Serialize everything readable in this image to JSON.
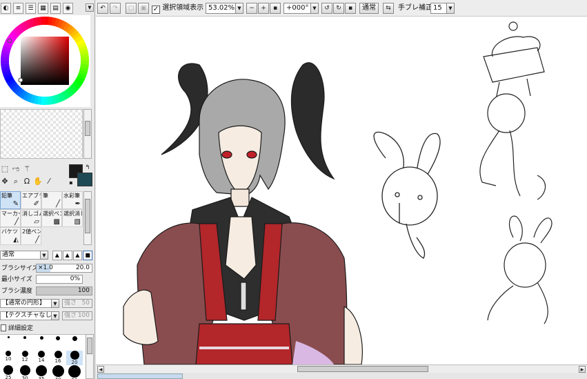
{
  "toolbar": {
    "show_selection_label": "選択領域表示",
    "show_selection_checked": "✓",
    "zoom": "53.02%",
    "rotation": "+000°",
    "blend_mode": "通常",
    "stabilizer_label": "手ブレ補正",
    "stabilizer_value": "15"
  },
  "brush_tools": [
    {
      "label": "鉛筆",
      "icon": "pencil-icon",
      "selected": true
    },
    {
      "label": "エアブラシ",
      "icon": "airbrush-icon"
    },
    {
      "label": "筆",
      "icon": "brush-icon"
    },
    {
      "label": "水彩筆",
      "icon": "watercolor-icon"
    },
    {
      "label": "マーカー",
      "icon": "marker-icon"
    },
    {
      "label": "消しゴム",
      "icon": "eraser-icon"
    },
    {
      "label": "選択ペン",
      "icon": "selection-pen-icon"
    },
    {
      "label": "選択消し",
      "icon": "selection-eraser-icon"
    },
    {
      "label": "バケツ",
      "icon": "bucket-icon"
    },
    {
      "label": "2値ペン",
      "icon": "binary-pen-icon"
    }
  ],
  "brush_props": {
    "mode": "通常",
    "size_label": "ブラシサイズ",
    "size_multiplier": "×1.0",
    "size_value": "20.0",
    "min_size_label": "最小サイズ",
    "min_size_value": "0%",
    "density_label": "ブラシ濃度",
    "density_value": "100",
    "shape": "【通常の円形】",
    "shape_strength_label": "強さ",
    "shape_strength_value": "50",
    "texture": "【テクスチャなし】",
    "texture_strength_label": "強さ",
    "texture_strength_value": "100",
    "advanced_label": "詳細設定"
  },
  "size_presets": [
    "",
    "",
    "",
    "",
    "",
    "10",
    "12",
    "14",
    "16",
    "20",
    "25",
    "30",
    "35",
    "40",
    "50"
  ],
  "colors": {
    "foreground": "#1a1a1a",
    "background": "#1f4a55",
    "accent_selection": "#cfe3f7"
  }
}
